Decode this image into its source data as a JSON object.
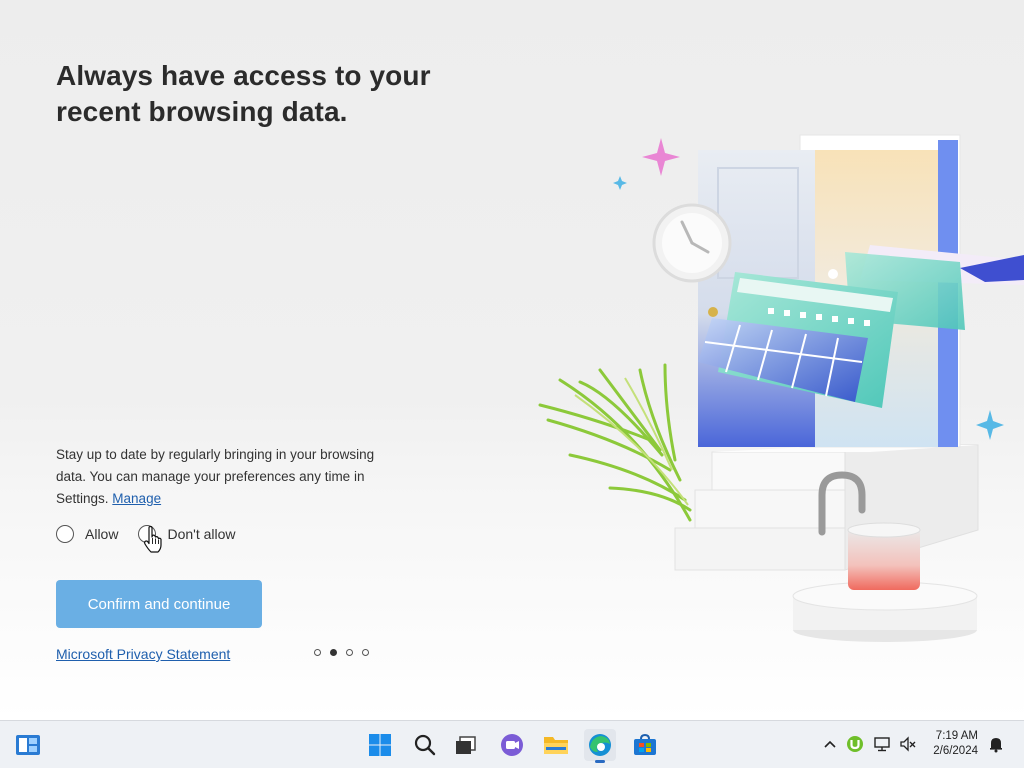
{
  "onboarding": {
    "headline": "Always have access to your recent browsing data.",
    "description": "Stay up to date by regularly bringing in your browsing data. You can manage your preferences any time in Settings.",
    "manage_link": "Manage",
    "options": [
      {
        "label": "Allow",
        "selected": false
      },
      {
        "label": "Don't allow",
        "selected": false
      }
    ],
    "confirm_label": "Confirm and continue",
    "privacy_link": "Microsoft Privacy Statement",
    "pagination": {
      "total": 4,
      "current": 2
    }
  },
  "taskbar": {
    "icons": [
      "widgets-icon",
      "start-icon",
      "search-icon",
      "task-view-icon",
      "chat-icon",
      "file-explorer-icon",
      "edge-icon",
      "store-icon"
    ],
    "time": "7:19 AM",
    "date": "2/6/2024"
  },
  "colors": {
    "accent": "#6aafe4",
    "link": "#1f5fad"
  }
}
